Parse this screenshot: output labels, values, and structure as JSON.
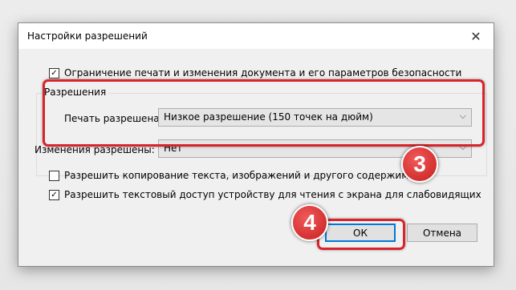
{
  "dialog": {
    "title": "Настройки разрешений",
    "close_glyph": "✕"
  },
  "restrict_checkbox": {
    "label": "Ограничение печати и изменения документа и его параметров безопасности",
    "checked": true,
    "mark": "✓"
  },
  "permissions": {
    "group_title": "Разрешения",
    "print_label": "Печать разрешена:",
    "print_value": "Низкое разрешение (150 точек на дюйм)",
    "changes_label": "Изменения разрешены:",
    "changes_value": "Нет",
    "dropdown_glyph": "⌵"
  },
  "copy_checkbox": {
    "label": "Разрешить копирование текста, изображений и другого содержимого",
    "checked": false,
    "mark": ""
  },
  "screenreader_checkbox": {
    "label": "Разрешить текстовый доступ устройству для чтения с экрана для слабовидящих",
    "checked": true,
    "mark": "✓"
  },
  "buttons": {
    "ok_label": "ОК",
    "cancel_label": "Отмена"
  },
  "annotations": {
    "step3": "3",
    "step4": "4",
    "highlight_color": "#d8242a"
  }
}
